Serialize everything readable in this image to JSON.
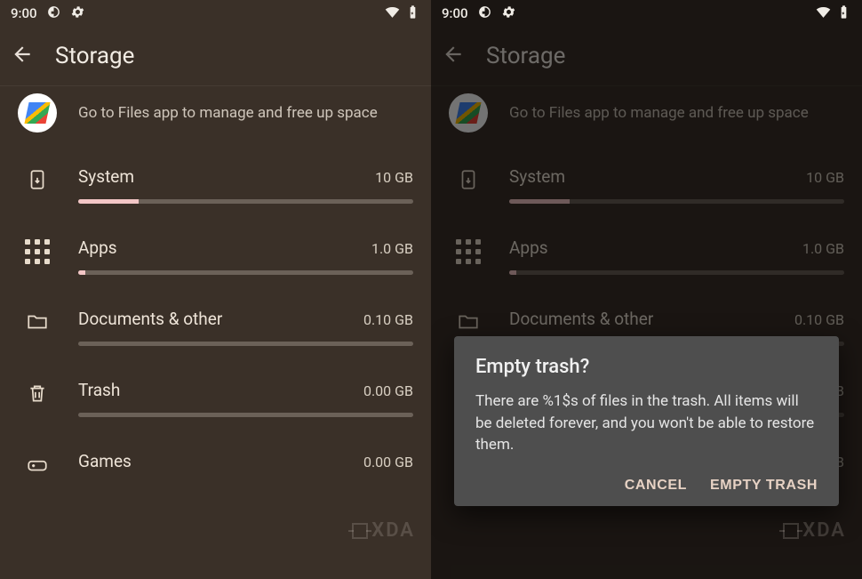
{
  "status": {
    "time": "9:00",
    "icons_left": [
      "data-saver",
      "settings-gear"
    ],
    "icons_right": [
      "wifi",
      "battery"
    ]
  },
  "header": {
    "title": "Storage"
  },
  "files_hint": "Go to Files app to manage and free up space",
  "categories": [
    {
      "key": "system",
      "label": "System",
      "size": "10 GB",
      "fill_pct": 18
    },
    {
      "key": "apps",
      "label": "Apps",
      "size": "1.0 GB",
      "fill_pct": 2
    },
    {
      "key": "docs",
      "label": "Documents & other",
      "size": "0.10 GB",
      "fill_pct": 0
    },
    {
      "key": "trash",
      "label": "Trash",
      "size": "0.00 GB",
      "fill_pct": 0
    },
    {
      "key": "games",
      "label": "Games",
      "size": "0.00 GB",
      "fill_pct": 0
    }
  ],
  "dialog": {
    "title": "Empty trash?",
    "body": "There are %1$s of files in the trash. All items will be deleted forever, and you won't be able to restore them.",
    "cancel": "CANCEL",
    "confirm": "EMPTY TRASH"
  },
  "watermark": "XDA"
}
